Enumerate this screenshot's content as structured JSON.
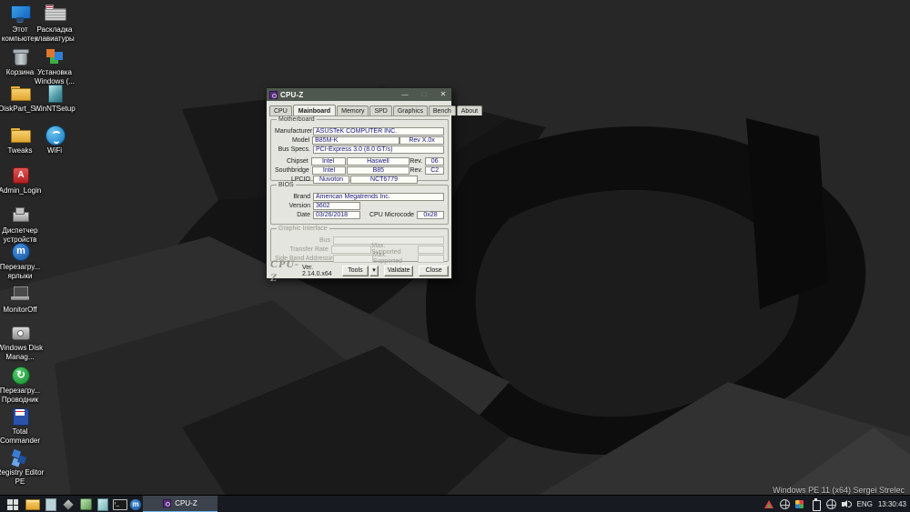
{
  "colors": {
    "titlebar": "#4f584f",
    "accent": "#6cb8ee",
    "field_text": "#16167e",
    "window_bg": "#e3e5de"
  },
  "desktop": {
    "watermark": "Windows PE 11 (x64) Sergei Strelec",
    "icons": [
      {
        "name": "this-pc",
        "label": "Этот компьютер"
      },
      {
        "name": "keyboard-layout",
        "label": "Раскладка клавиатуры"
      },
      {
        "name": "recycle-bin",
        "label": "Корзина"
      },
      {
        "name": "windows-setup",
        "label": "Установка Windows (..."
      },
      {
        "name": "diskpart",
        "label": "DiskPart_S..."
      },
      {
        "name": "winntsetup",
        "label": "WinNTSetup"
      },
      {
        "name": "tweaks",
        "label": "Tweaks"
      },
      {
        "name": "wifi",
        "label": "WiFi"
      },
      {
        "name": "admin-login",
        "label": "Admin_Login"
      },
      {
        "name": "device-manager",
        "label": "Диспетчер устройств"
      },
      {
        "name": "reload-shortcuts",
        "label": "Перезагру... ярлыки"
      },
      {
        "name": "monitor-off",
        "label": "MonitorOff"
      },
      {
        "name": "disk-management",
        "label": "Windows Disk Manag..."
      },
      {
        "name": "restart-explorer",
        "label": "Перезагру... Проводник"
      },
      {
        "name": "total-commander",
        "label": "Total Commander"
      },
      {
        "name": "registry-editor-pe",
        "label": "Registry Editor PE"
      }
    ]
  },
  "window": {
    "title": "CPU-Z",
    "tabs": [
      "CPU",
      "Mainboard",
      "Memory",
      "SPD",
      "Graphics",
      "Bench",
      "About"
    ],
    "motherboard": {
      "legend": "Motherboard",
      "manufacturer_label": "Manufacturer",
      "manufacturer": "ASUSTeK COMPUTER INC.",
      "model_label": "Model",
      "model": "B85M-K",
      "model_rev": "Rev X.0x",
      "bus_label": "Bus Specs.",
      "bus": "PCI-Express 3.0 (8.0 GT/s)",
      "chipset_label": "Chipset",
      "chipset_vendor": "Intel",
      "chipset_name": "Haswell",
      "chipset_rev_label": "Rev.",
      "chipset_rev": "06",
      "southbridge_label": "Southbridge",
      "southbridge_vendor": "Intel",
      "southbridge_name": "B85",
      "southbridge_rev_label": "Rev.",
      "southbridge_rev": "C2",
      "lpcio_label": "LPCIO",
      "lpcio_vendor": "Nuvoton",
      "lpcio_name": "NCT6779"
    },
    "bios": {
      "legend": "BIOS",
      "brand_label": "Brand",
      "brand": "American Megatrends Inc.",
      "version_label": "Version",
      "version": "3602",
      "date_label": "Date",
      "date": "03/26/2018",
      "microcode_label": "CPU Microcode",
      "microcode": "0x28"
    },
    "graphic_interface": {
      "legend": "Graphic Interface",
      "bus_label": "Bus",
      "transfer_label": "Transfer Rate",
      "max_supported_label": "Max. Supported",
      "sideband_label": "Side Band Addressing",
      "max_supported_label2": "Max. Supported"
    },
    "footer": {
      "logo": "CPU-Z",
      "version": "Ver. 2.14.0.x64",
      "tools": "Tools",
      "validate": "Validate",
      "close": "Close"
    }
  },
  "taskbar": {
    "task_button": "CPU-Z",
    "lang": "ENG",
    "time": "13:30:43"
  }
}
